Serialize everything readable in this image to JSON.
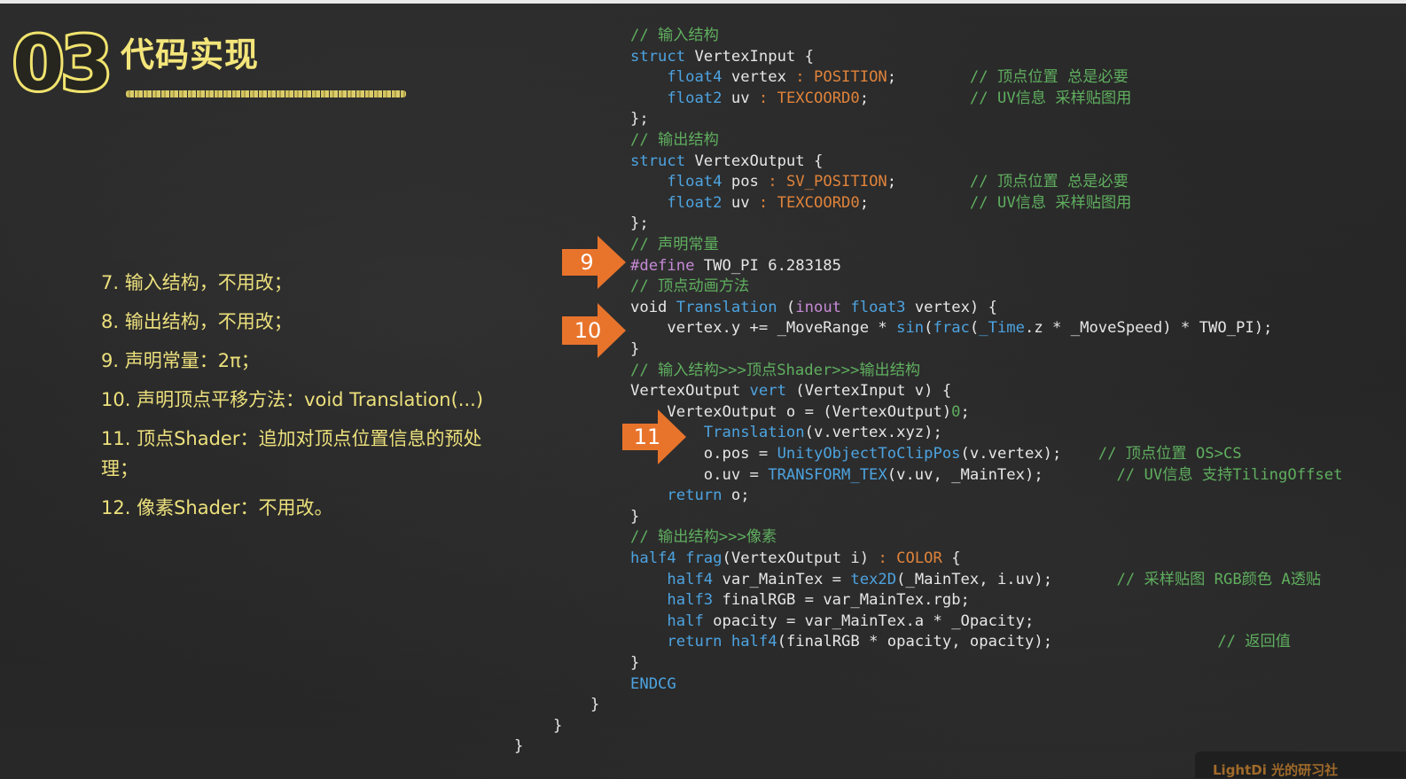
{
  "header": {
    "section_number": "03",
    "section_title": "代码实现"
  },
  "steps": [
    "7. 输入结构，不用改；",
    "8. 输出结构，不用改；",
    "9. 声明常量：2π；",
    "10. 声明顶点平移方法：void Translation(...)",
    "11. 顶点Shader：追加对顶点位置信息的预处理；",
    "12. 像素Shader：不用改。"
  ],
  "markers": [
    "9",
    "10",
    "11"
  ],
  "code": {
    "lines": [
      [
        [
          "c-comment",
          "// 输入结构"
        ]
      ],
      [
        [
          "c-kw",
          "struct"
        ],
        [
          "c-plain",
          " VertexInput {"
        ]
      ],
      [
        [
          "c-plain",
          "    "
        ],
        [
          "c-type",
          "float4"
        ],
        [
          "c-plain",
          " vertex "
        ],
        [
          "c-sem",
          ": POSITION"
        ],
        [
          "c-plain",
          ";        "
        ],
        [
          "c-comment",
          "// 顶点位置 总是必要"
        ]
      ],
      [
        [
          "c-plain",
          "    "
        ],
        [
          "c-type",
          "float2"
        ],
        [
          "c-plain",
          " uv "
        ],
        [
          "c-sem",
          ": TEXCOORD0"
        ],
        [
          "c-plain",
          ";           "
        ],
        [
          "c-comment",
          "// UV信息 采样贴图用"
        ]
      ],
      [
        [
          "c-plain",
          "};"
        ]
      ],
      [
        [
          "c-comment",
          "// 输出结构"
        ]
      ],
      [
        [
          "c-kw",
          "struct"
        ],
        [
          "c-plain",
          " VertexOutput {"
        ]
      ],
      [
        [
          "c-plain",
          "    "
        ],
        [
          "c-type",
          "float4"
        ],
        [
          "c-plain",
          " pos "
        ],
        [
          "c-sem",
          ": SV_POSITION"
        ],
        [
          "c-plain",
          ";        "
        ],
        [
          "c-comment",
          "// 顶点位置 总是必要"
        ]
      ],
      [
        [
          "c-plain",
          "    "
        ],
        [
          "c-type",
          "float2"
        ],
        [
          "c-plain",
          " uv "
        ],
        [
          "c-sem",
          ": TEXCOORD0"
        ],
        [
          "c-plain",
          ";           "
        ],
        [
          "c-comment",
          "// UV信息 采样贴图用"
        ]
      ],
      [
        [
          "c-plain",
          "};"
        ]
      ],
      [
        [
          "c-comment",
          "// 声明常量"
        ]
      ],
      [
        [
          "c-pre",
          "#define"
        ],
        [
          "c-plain",
          " TWO_PI 6.283185"
        ]
      ],
      [
        [
          "c-comment",
          "// 顶点动画方法"
        ]
      ],
      [
        [
          "c-plain",
          "void "
        ],
        [
          "c-kw",
          "Translation"
        ],
        [
          "c-plain",
          " ("
        ],
        [
          "c-pre",
          "inout"
        ],
        [
          "c-plain",
          " "
        ],
        [
          "c-type",
          "float3"
        ],
        [
          "c-plain",
          " vertex) {"
        ]
      ],
      [
        [
          "c-plain",
          "    vertex.y += _MoveRange * "
        ],
        [
          "c-kw",
          "sin"
        ],
        [
          "c-plain",
          "("
        ],
        [
          "c-kw",
          "frac"
        ],
        [
          "c-plain",
          "("
        ],
        [
          "c-kw",
          "_Time"
        ],
        [
          "c-plain",
          ".z * _MoveSpeed) * TWO_PI);"
        ]
      ],
      [
        [
          "c-plain",
          "}"
        ]
      ],
      [
        [
          "c-comment",
          "// 输入结构>>>顶点Shader>>>输出结构"
        ]
      ],
      [
        [
          "c-plain",
          "VertexOutput "
        ],
        [
          "c-kw",
          "vert"
        ],
        [
          "c-plain",
          " (VertexInput v) {"
        ]
      ],
      [
        [
          "c-plain",
          "    VertexOutput o = (VertexOutput)"
        ],
        [
          "c-comment",
          "0"
        ],
        [
          "c-plain",
          ";"
        ]
      ],
      [
        [
          "c-plain",
          "        "
        ],
        [
          "c-kw",
          "Translation"
        ],
        [
          "c-plain",
          "(v.vertex.xyz);"
        ]
      ],
      [
        [
          "c-plain",
          "        o.pos = "
        ],
        [
          "c-kw",
          "UnityObjectToClipPos"
        ],
        [
          "c-plain",
          "(v.vertex);    "
        ],
        [
          "c-comment",
          "// 顶点位置 OS>CS"
        ]
      ],
      [
        [
          "c-plain",
          "        o.uv = "
        ],
        [
          "c-kw",
          "TRANSFORM_TEX"
        ],
        [
          "c-plain",
          "(v.uv, _MainTex);        "
        ],
        [
          "c-comment",
          "// UV信息 支持TilingOffset"
        ]
      ],
      [
        [
          "c-plain",
          "    "
        ],
        [
          "c-kw",
          "return"
        ],
        [
          "c-plain",
          " o;"
        ]
      ],
      [
        [
          "c-plain",
          "}"
        ]
      ],
      [
        [
          "c-comment",
          "// 输出结构>>>像素"
        ]
      ],
      [
        [
          "c-type",
          "half4"
        ],
        [
          "c-plain",
          " "
        ],
        [
          "c-kw",
          "frag"
        ],
        [
          "c-plain",
          "(VertexOutput i) "
        ],
        [
          "c-sem",
          ": COLOR"
        ],
        [
          "c-plain",
          " {"
        ]
      ],
      [
        [
          "c-plain",
          "    "
        ],
        [
          "c-type",
          "half4"
        ],
        [
          "c-plain",
          " var_MainTex = "
        ],
        [
          "c-kw",
          "tex2D"
        ],
        [
          "c-plain",
          "(_MainTex, i.uv);       "
        ],
        [
          "c-comment",
          "// 采样贴图 RGB颜色 A透贴"
        ]
      ],
      [
        [
          "c-plain",
          "    "
        ],
        [
          "c-type",
          "half3"
        ],
        [
          "c-plain",
          " finalRGB = var_MainTex.rgb;"
        ]
      ],
      [
        [
          "c-plain",
          "    "
        ],
        [
          "c-type",
          "half"
        ],
        [
          "c-plain",
          " opacity = var_MainTex.a * _Opacity;"
        ]
      ],
      [
        [
          "c-plain",
          "    "
        ],
        [
          "c-kw",
          "return"
        ],
        [
          "c-plain",
          " "
        ],
        [
          "c-type",
          "half4"
        ],
        [
          "c-plain",
          "(finalRGB * opacity, opacity);                  "
        ],
        [
          "c-comment",
          "// 返回值"
        ]
      ],
      [
        [
          "c-plain",
          "}"
        ]
      ],
      [
        [
          "c-kw",
          "ENDCG"
        ]
      ],
      [
        [
          "c-plain",
          "}"
        ]
      ],
      [
        [
          "c-plain",
          "}"
        ]
      ],
      [
        [
          "c-plain",
          "}"
        ]
      ]
    ]
  },
  "logo": {
    "text": "LightDi 光的研习社"
  },
  "colors": {
    "background": "#262626",
    "accent_yellow": "#ece07c",
    "marker_orange": "#e8742c",
    "comment_green": "#5fae5f",
    "keyword_blue": "#4da3e0",
    "semantic_orange": "#e0833a",
    "preprocessor_purple": "#c68ad6"
  }
}
